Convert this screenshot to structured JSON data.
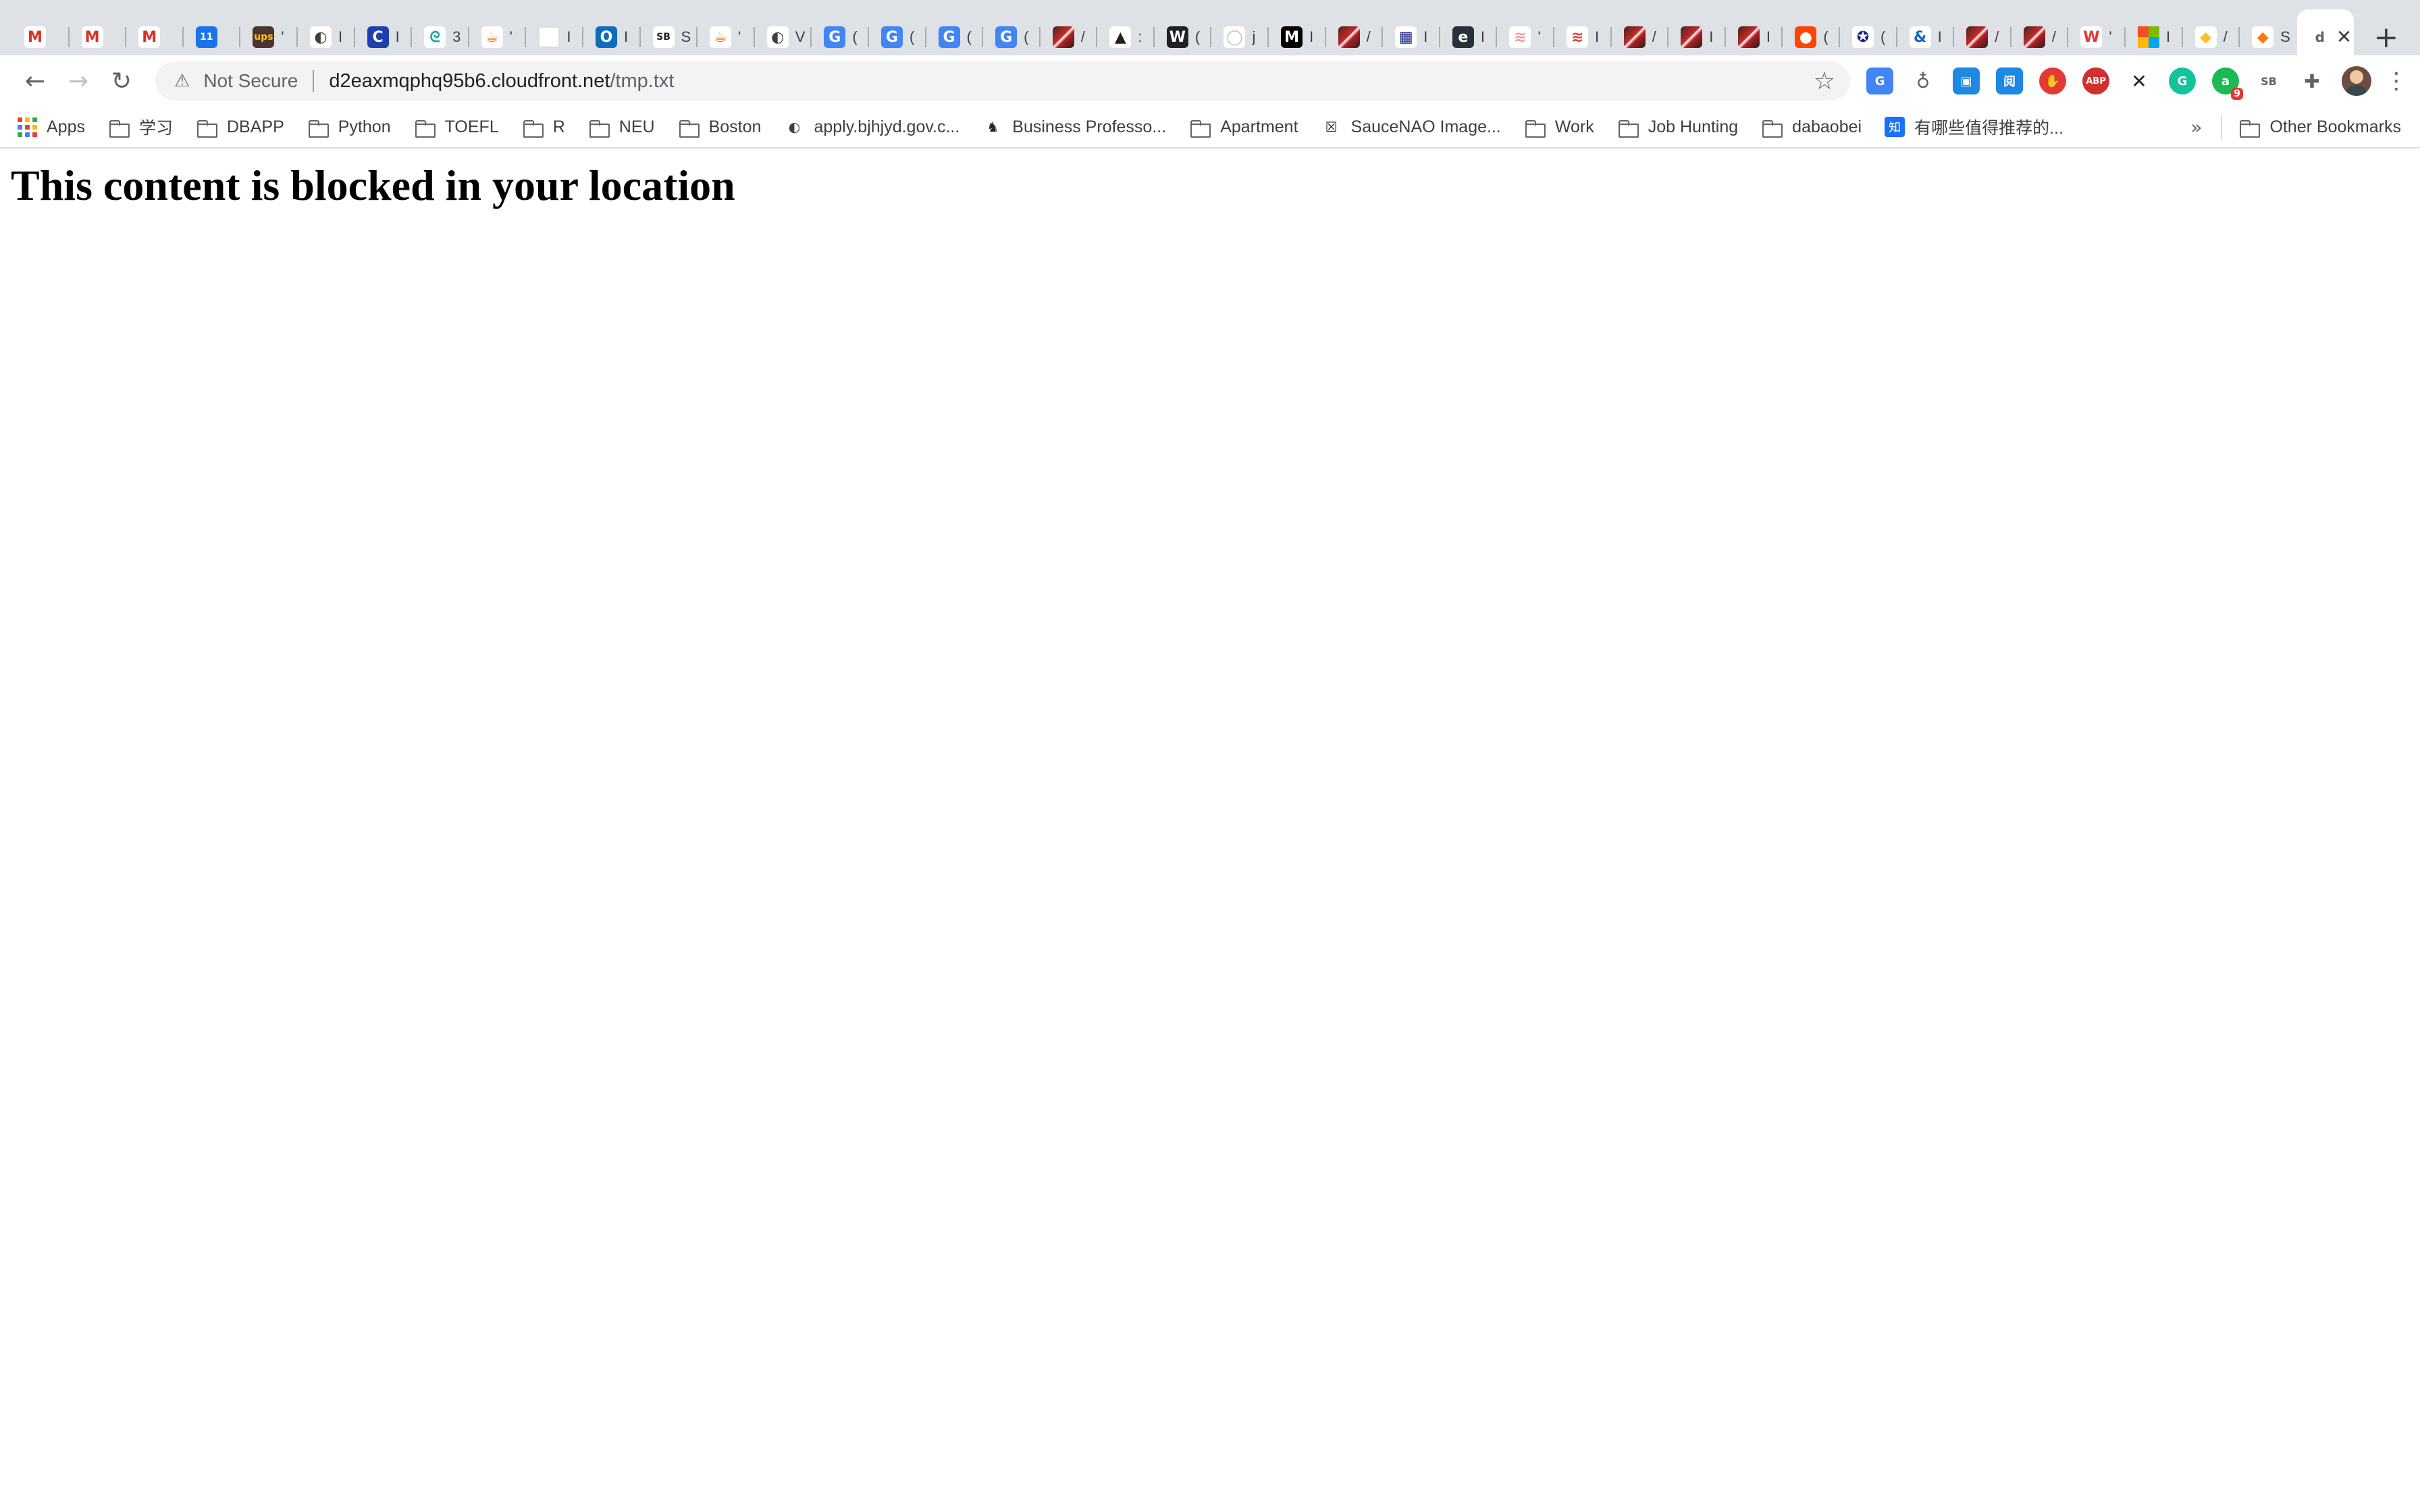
{
  "tabs": [
    {
      "icon": "gmail-icon",
      "glyph": "M",
      "color": "#ffffff",
      "fg": "#d93025",
      "title": ""
    },
    {
      "icon": "gmail-icon",
      "glyph": "M",
      "color": "#ffffff",
      "fg": "#d93025",
      "title": ""
    },
    {
      "icon": "gmail-icon",
      "glyph": "M",
      "color": "#ffffff",
      "fg": "#d93025",
      "title": ""
    },
    {
      "icon": "calendar-icon",
      "glyph": "11",
      "color": "#1a73e8",
      "fg": "#ffffff",
      "title": ""
    },
    {
      "icon": "ups-icon",
      "glyph": "ups",
      "color": "#4e342e",
      "fg": "#ffc107",
      "title": "'"
    },
    {
      "icon": "globe-icon",
      "glyph": "◐",
      "color": "#ffffff",
      "fg": "#3c4043",
      "title": "I"
    },
    {
      "icon": "circle-c-icon",
      "glyph": "C",
      "color": "#1e40af",
      "fg": "#ffffff",
      "title": "I"
    },
    {
      "icon": "swirl-icon",
      "glyph": "ᘓ",
      "color": "#ffffff",
      "fg": "#26a69a",
      "title": "3"
    },
    {
      "icon": "java-icon",
      "glyph": "☕",
      "color": "#ffffff",
      "fg": "#f57c00",
      "title": "'"
    },
    {
      "icon": "blank-page-icon",
      "glyph": "",
      "color": "#ffffff",
      "fg": "#ffffff",
      "title": "I"
    },
    {
      "icon": "outlook-icon",
      "glyph": "O",
      "color": "#0f6cbd",
      "fg": "#ffffff",
      "title": "I"
    },
    {
      "icon": "sb-icon",
      "glyph": "SB",
      "color": "#ffffff",
      "fg": "#202124",
      "title": "S"
    },
    {
      "icon": "java-icon",
      "glyph": "☕",
      "color": "#ffffff",
      "fg": "#f57c00",
      "title": "'"
    },
    {
      "icon": "globe-icon",
      "glyph": "◐",
      "color": "#ffffff",
      "fg": "#3c4043",
      "title": "V"
    },
    {
      "icon": "translate-icon",
      "glyph": "G",
      "color": "#4285f4",
      "fg": "#ffffff",
      "title": "("
    },
    {
      "icon": "translate-icon",
      "glyph": "G",
      "color": "#4285f4",
      "fg": "#ffffff",
      "title": "("
    },
    {
      "icon": "translate-icon",
      "glyph": "G",
      "color": "#4285f4",
      "fg": "#ffffff",
      "title": "("
    },
    {
      "icon": "translate-icon",
      "glyph": "G",
      "color": "#4285f4",
      "fg": "#ffffff",
      "title": "("
    },
    {
      "icon": "anime-icon",
      "glyph": "",
      "color": "#7b1f1f",
      "fg": "#ffffff",
      "title": "/"
    },
    {
      "icon": "triangle-icon",
      "glyph": "▲",
      "color": "#ffffff",
      "fg": "#202124",
      "title": ":"
    },
    {
      "icon": "w-icon",
      "glyph": "W",
      "color": "#202124",
      "fg": "#ffffff",
      "title": "("
    },
    {
      "icon": "github-icon",
      "glyph": "◯",
      "color": "#ffffff",
      "fg": "#bdbdbd",
      "title": "j"
    },
    {
      "icon": "medium-icon",
      "glyph": "M",
      "color": "#000000",
      "fg": "#ffffff",
      "title": "I"
    },
    {
      "icon": "anime-icon",
      "glyph": "",
      "color": "#7b1f1f",
      "fg": "#ffffff",
      "title": "/"
    },
    {
      "icon": "grid-icon",
      "glyph": "▦",
      "color": "#ffffff",
      "fg": "#1a237e",
      "title": "I"
    },
    {
      "icon": "edge-icon",
      "glyph": "e",
      "color": "#263238",
      "fg": "#ffffff",
      "title": "I"
    },
    {
      "icon": "layers-icon",
      "glyph": "≋",
      "color": "#ffffff",
      "fg": "#ef9a9a",
      "title": "'"
    },
    {
      "icon": "layers-icon",
      "glyph": "≋",
      "color": "#ffffff",
      "fg": "#e53935",
      "title": "I"
    },
    {
      "icon": "anime-icon",
      "glyph": "",
      "color": "#7b1f1f",
      "fg": "#ffffff",
      "title": "/"
    },
    {
      "icon": "anime-icon",
      "glyph": "",
      "color": "#7b1f1f",
      "fg": "#ffffff",
      "title": "I"
    },
    {
      "icon": "anime-icon",
      "glyph": "",
      "color": "#7b1f1f",
      "fg": "#ffffff",
      "title": "I"
    },
    {
      "icon": "reddit-icon",
      "glyph": "●",
      "color": "#ff4500",
      "fg": "#ffffff",
      "title": "("
    },
    {
      "icon": "seal-icon",
      "glyph": "✪",
      "color": "#ffffff",
      "fg": "#1a237e",
      "title": "("
    },
    {
      "icon": "ampersand-icon",
      "glyph": "&",
      "color": "#ffffff",
      "fg": "#1565c0",
      "title": "I"
    },
    {
      "icon": "anime-icon",
      "glyph": "",
      "color": "#7b1f1f",
      "fg": "#ffffff",
      "title": "/"
    },
    {
      "icon": "anime-icon",
      "glyph": "",
      "color": "#7b1f1f",
      "fg": "#ffffff",
      "title": "/"
    },
    {
      "icon": "w-icon",
      "glyph": "W",
      "color": "#ffffff",
      "fg": "#e53935",
      "title": "'"
    },
    {
      "icon": "microsoft-icon",
      "glyph": "",
      "color": "#ffffff",
      "fg": "#ffffff",
      "title": "I"
    },
    {
      "icon": "box-icon",
      "glyph": "◆",
      "color": "#ffffff",
      "fg": "#fbc02d",
      "title": "/"
    },
    {
      "icon": "box-icon",
      "glyph": "◆",
      "color": "#ffffff",
      "fg": "#f57c00",
      "title": "S"
    }
  ],
  "active_tab": {
    "icon": "page-icon",
    "title": "d",
    "close_glyph": "✕"
  },
  "new_tab_glyph": "+",
  "toolbar": {
    "back_glyph": "←",
    "forward_glyph": "→",
    "reload_glyph": "↻",
    "warning_glyph": "⚠",
    "security_label": "Not Secure",
    "url_host": "d2eaxmqphq95b6.cloudfront.net",
    "url_path": "/tmp.txt",
    "star_glyph": "☆",
    "menu_glyph": "⋮"
  },
  "extensions": [
    {
      "icon": "translate-extension-icon",
      "glyph": "G",
      "color": "#4285f4"
    },
    {
      "icon": "lightbulb-extension-icon",
      "glyph": "♁",
      "color": "#5f6368"
    },
    {
      "icon": "screen-extension-icon",
      "glyph": "▣",
      "color": "#1e88e5"
    },
    {
      "icon": "reader-extension-icon",
      "glyph": "阅",
      "color": "#1e88e5"
    },
    {
      "icon": "hand-stop-extension-icon",
      "glyph": "✋",
      "color": "#e53935"
    },
    {
      "icon": "adblock-extension-icon",
      "glyph": "ABP",
      "color": "#d32f2f"
    },
    {
      "icon": "x-extension-icon",
      "glyph": "✕",
      "color": "#202124"
    },
    {
      "icon": "grammarly-extension-icon",
      "glyph": "G",
      "color": "#15c39a"
    },
    {
      "icon": "counter-extension-icon",
      "glyph": "a",
      "color": "#1db954",
      "badge": "9"
    },
    {
      "icon": "sb-extension-icon",
      "glyph": "SB",
      "color": "#5f6368"
    },
    {
      "icon": "puzzle-extensions-icon",
      "glyph": "✚",
      "color": "#5f6368"
    }
  ],
  "bookmarks": [
    {
      "kind": "apps",
      "label": "Apps"
    },
    {
      "kind": "folder",
      "label": "学习"
    },
    {
      "kind": "folder",
      "label": "DBAPP"
    },
    {
      "kind": "folder",
      "label": "Python"
    },
    {
      "kind": "folder",
      "label": "TOEFL"
    },
    {
      "kind": "folder",
      "label": "R"
    },
    {
      "kind": "folder",
      "label": "NEU"
    },
    {
      "kind": "folder",
      "label": "Boston"
    },
    {
      "kind": "globe",
      "label": "apply.bjhjyd.gov.c...",
      "glyph": "◐",
      "color": "#3c4043"
    },
    {
      "kind": "glyph",
      "label": "Business Professo...",
      "glyph": "♞",
      "color": "#202124"
    },
    {
      "kind": "folder",
      "label": "Apartment"
    },
    {
      "kind": "glyph",
      "label": "SauceNAO Image...",
      "glyph": "☒",
      "color": "#202124"
    },
    {
      "kind": "folder",
      "label": "Work"
    },
    {
      "kind": "folder",
      "label": "Job Hunting"
    },
    {
      "kind": "folder",
      "label": "dabaobei"
    },
    {
      "kind": "glyph",
      "label": "有哪些值得推荐的...",
      "glyph": "知",
      "color": "#1772f6"
    }
  ],
  "bookmarks_more_glyph": "»",
  "other_bookmarks_label": "Other Bookmarks",
  "page": {
    "heading": "This content is blocked in your location"
  }
}
